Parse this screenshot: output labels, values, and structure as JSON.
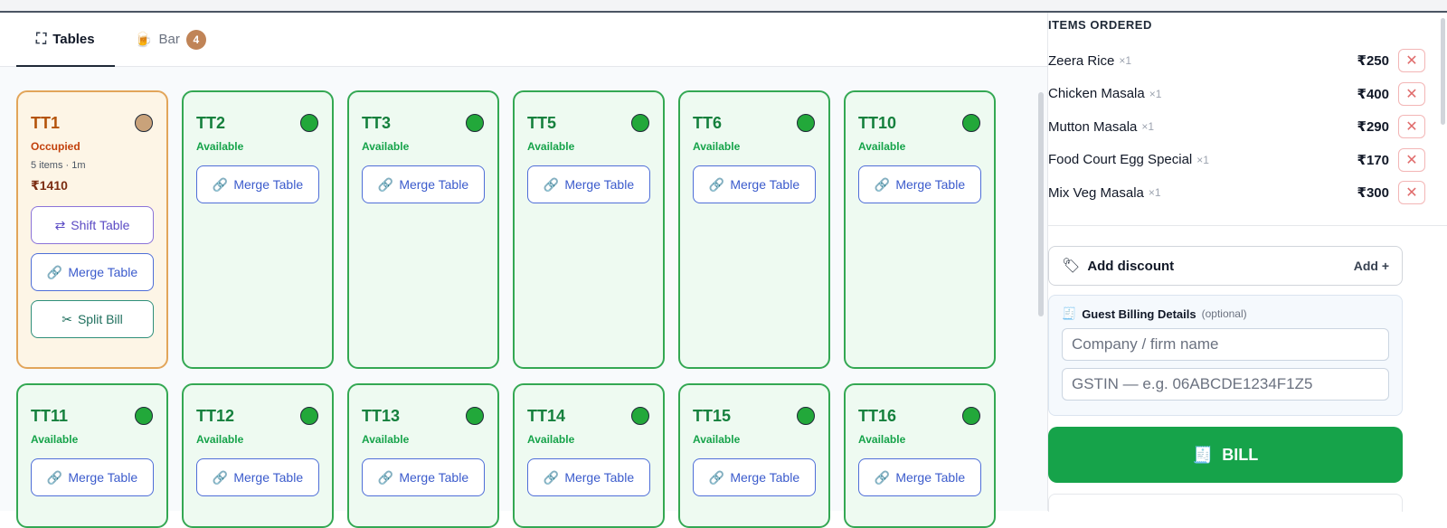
{
  "tabs": [
    {
      "label": "Tables",
      "icon": "table-icon"
    },
    {
      "label": "Bar",
      "icon": "beer-icon",
      "badge": "4"
    }
  ],
  "tables": [
    {
      "name": "TT1",
      "status": "Occupied",
      "meta": "5 items · 1m",
      "amount": "₹1410",
      "actions": [
        "Shift Table",
        "Merge Table",
        "Split Bill"
      ]
    },
    {
      "name": "TT2",
      "status": "Available",
      "action": "Merge Table"
    },
    {
      "name": "TT3",
      "status": "Available",
      "action": "Merge Table"
    },
    {
      "name": "TT5",
      "status": "Available",
      "action": "Merge Table"
    },
    {
      "name": "TT6",
      "status": "Available",
      "action": "Merge Table"
    },
    {
      "name": "TT10",
      "status": "Available",
      "action": "Merge Table"
    },
    {
      "name": "TT11",
      "status": "Available",
      "action": "Merge Table"
    },
    {
      "name": "TT12",
      "status": "Available",
      "action": "Merge Table"
    },
    {
      "name": "TT13",
      "status": "Available",
      "action": "Merge Table"
    },
    {
      "name": "TT14",
      "status": "Available",
      "action": "Merge Table"
    },
    {
      "name": "TT15",
      "status": "Available",
      "action": "Merge Table"
    },
    {
      "name": "TT16",
      "status": "Available",
      "action": "Merge Table"
    }
  ],
  "order": {
    "title": "ITEMS ORDERED",
    "items": [
      {
        "name": "Zeera Rice",
        "qty": "×1",
        "price": "₹250"
      },
      {
        "name": "Chicken Masala",
        "qty": "×1",
        "price": "₹400"
      },
      {
        "name": "Mutton Masala",
        "qty": "×1",
        "price": "₹290"
      },
      {
        "name": "Food Court Egg Special",
        "qty": "×1",
        "price": "₹170"
      },
      {
        "name": "Mix Veg Masala",
        "qty": "×1",
        "price": "₹300"
      }
    ],
    "remove_symbol": "✕"
  },
  "discount": {
    "label": "Add discount",
    "add_label": "Add +"
  },
  "billing": {
    "title": "Guest Billing Details",
    "optional": "(optional)",
    "company_placeholder": "Company / firm name",
    "gstin_placeholder": "GSTIN — e.g. 06ABCDE1234F1Z5"
  },
  "bill_button": {
    "label": "BILL"
  },
  "colors": {
    "available": "#16a34a",
    "occupied": "#b45309",
    "bill": "#16a34a",
    "merge": "#3b5bcc"
  }
}
